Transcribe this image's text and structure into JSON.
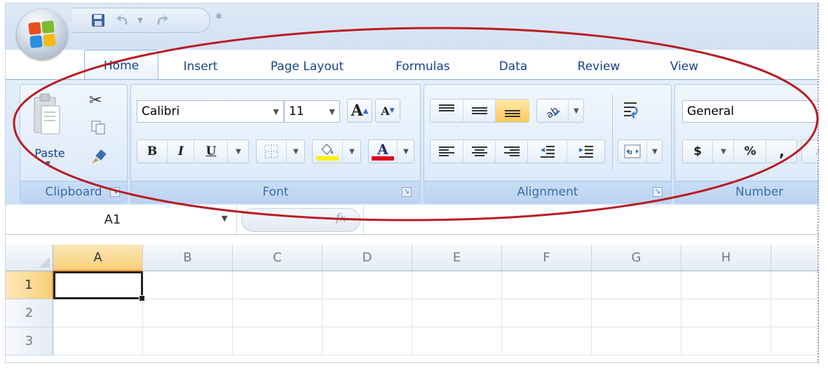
{
  "quick_access": {
    "save_icon": "save-icon",
    "undo_icon": "undo-icon",
    "redo_icon": "redo-icon",
    "customize_icon": "customize-qat-icon"
  },
  "tabs": [
    {
      "label": "Home",
      "active": true
    },
    {
      "label": "Insert"
    },
    {
      "label": "Page Layout"
    },
    {
      "label": "Formulas"
    },
    {
      "label": "Data"
    },
    {
      "label": "Review"
    },
    {
      "label": "View"
    }
  ],
  "clipboard": {
    "paste_label": "Paste",
    "group_label": "Clipboard"
  },
  "font": {
    "font_name": "Calibri",
    "font_size": "11",
    "grow_label": "A",
    "shrink_label": "A",
    "bold_label": "B",
    "italic_label": "I",
    "underline_label": "U",
    "color_label": "A",
    "group_label": "Font",
    "fill_color": "#ffee00",
    "font_color": "#e0001a"
  },
  "alignment": {
    "group_label": "Alignment"
  },
  "number": {
    "format": "General",
    "currency_label": "$",
    "percent_label": "%",
    "comma_label": ",",
    "group_label": "Number"
  },
  "formula_bar": {
    "name_box": "A1",
    "fx_label": "fx"
  },
  "sheet": {
    "columns": [
      "A",
      "B",
      "C",
      "D",
      "E",
      "F",
      "G",
      "H"
    ],
    "rows": [
      "1",
      "2",
      "3"
    ],
    "active_cell": "A1"
  },
  "colors": {
    "annotation": "#b81c22",
    "highlight": "#ffc95a"
  }
}
